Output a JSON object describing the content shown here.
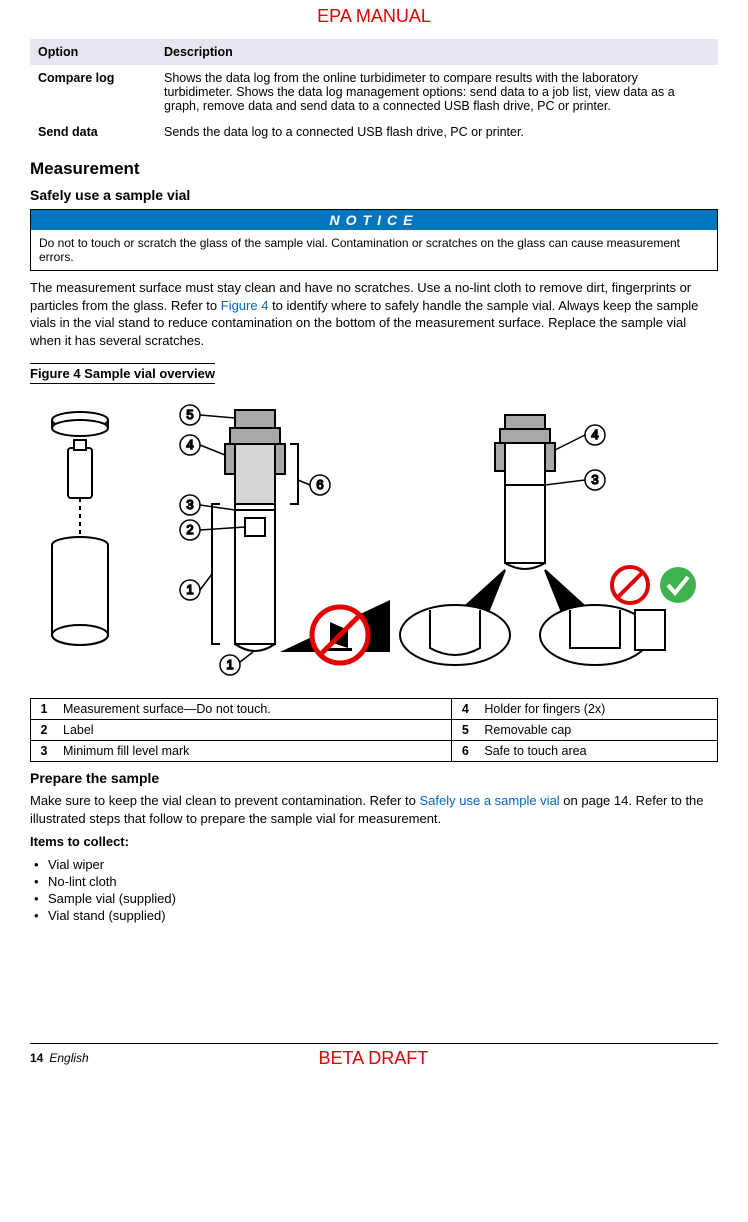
{
  "header": "EPA MANUAL",
  "options_table": {
    "head_option": "Option",
    "head_desc": "Description",
    "rows": [
      {
        "opt": "Compare log",
        "desc": "Shows the data log from the online turbidimeter to compare results with the laboratory turbidimeter. Shows the data log management options: send data to a job list, view data as a graph, remove data and send data to a connected USB flash drive, PC or printer."
      },
      {
        "opt": "Send data",
        "desc": "Sends the data log to a connected USB flash drive, PC or printer."
      }
    ]
  },
  "measurement_heading": "Measurement",
  "safevial_heading": "Safely use a sample vial",
  "notice_label": "NOTICE",
  "notice_body": "Do not to touch or scratch the glass of the sample vial. Contamination or scratches on the glass can cause measurement errors.",
  "paragraph1_a": "The measurement surface must stay clean and have no scratches. Use a no-lint cloth to remove dirt, fingerprints or particles from the glass. Refer to ",
  "paragraph1_link": "Figure 4",
  "paragraph1_b": " to identify where to safely handle the sample vial. Always keep the sample vials in the vial stand to reduce contamination on the bottom of the measurement surface. Replace the sample vial when it has several scratches.",
  "figure_caption": "Figure 4  Sample vial overview",
  "legend_rows": [
    {
      "n1": "1",
      "t1": "Measurement surface—Do not touch.",
      "n2": "4",
      "t2": "Holder for fingers (2x)"
    },
    {
      "n1": "2",
      "t1": "Label",
      "n2": "5",
      "t2": "Removable cap"
    },
    {
      "n1": "3",
      "t1": "Minimum fill level mark",
      "n2": "6",
      "t2": "Safe to touch area"
    }
  ],
  "prepare_heading": "Prepare the sample",
  "prepare_text_a": "Make sure to keep the vial clean to prevent contamination. Refer to ",
  "prepare_link": "Safely use a sample vial",
  "prepare_text_b": " on page 14. Refer to the illustrated steps that follow to prepare the sample vial for measurement.",
  "items_heading": "Items to collect:",
  "items": [
    "Vial wiper",
    "No-lint cloth",
    "Sample vial (supplied)",
    "Vial stand (supplied)"
  ],
  "footer_page": "14",
  "footer_lang": "English",
  "footer_draft": "BETA DRAFT",
  "callouts": {
    "c1": "1",
    "c2": "2",
    "c3": "3",
    "c4": "4",
    "c5": "5",
    "c6": "6"
  }
}
